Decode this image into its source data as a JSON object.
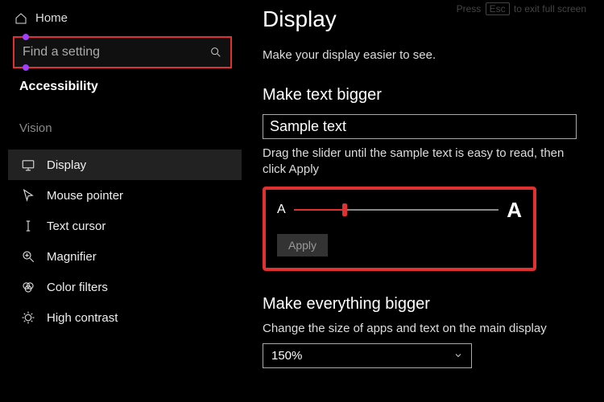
{
  "sidebar": {
    "home_label": "Home",
    "search_placeholder": "Find a setting",
    "section_title": "Accessibility",
    "group_label": "Vision",
    "items": [
      {
        "label": "Display"
      },
      {
        "label": "Mouse pointer"
      },
      {
        "label": "Text cursor"
      },
      {
        "label": "Magnifier"
      },
      {
        "label": "Color filters"
      },
      {
        "label": "High contrast"
      }
    ]
  },
  "hint": {
    "press": "Press",
    "key": "Esc",
    "rest": "to exit full screen"
  },
  "main": {
    "title": "Display",
    "subtitle": "Make your display easier to see.",
    "section1": "Make text bigger",
    "sample": "Sample text",
    "instruction": "Drag the slider until the sample text is easy to read, then click Apply",
    "small_a": "A",
    "big_a": "A",
    "apply": "Apply",
    "section2": "Make everything bigger",
    "instruction2": "Change the size of apps and text on the main display",
    "dropdown_value": "150%"
  }
}
